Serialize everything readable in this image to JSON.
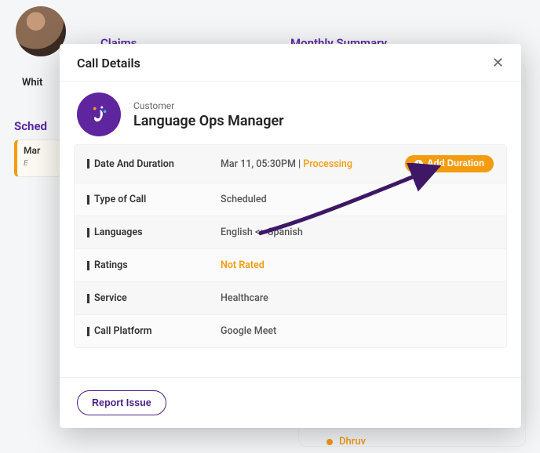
{
  "background": {
    "user_name_truncated": "Whit",
    "claims_tab": "Claims",
    "monthly_tab": "Monthly Summary",
    "sched_label": "Sched",
    "card_line1": "Mar",
    "card_line2": "E",
    "dhruv": "Dhruv"
  },
  "modal": {
    "title": "Call Details",
    "customer": {
      "label": "Customer",
      "name": "Language Ops Manager"
    },
    "rows": {
      "date_and_duration": {
        "label": "Date And Duration",
        "datetime": "Mar 11, 05:30PM",
        "separator": " | ",
        "status": "Processing",
        "action_label": "Add Duration"
      },
      "type_of_call": {
        "label": "Type of Call",
        "value": "Scheduled"
      },
      "languages": {
        "label": "Languages",
        "value": "English <> Spanish"
      },
      "ratings": {
        "label": "Ratings",
        "value": "Not Rated"
      },
      "service": {
        "label": "Service",
        "value": "Healthcare"
      },
      "call_platform": {
        "label": "Call Platform",
        "value": "Google Meet"
      }
    },
    "footer": {
      "report_issue": "Report Issue"
    }
  }
}
